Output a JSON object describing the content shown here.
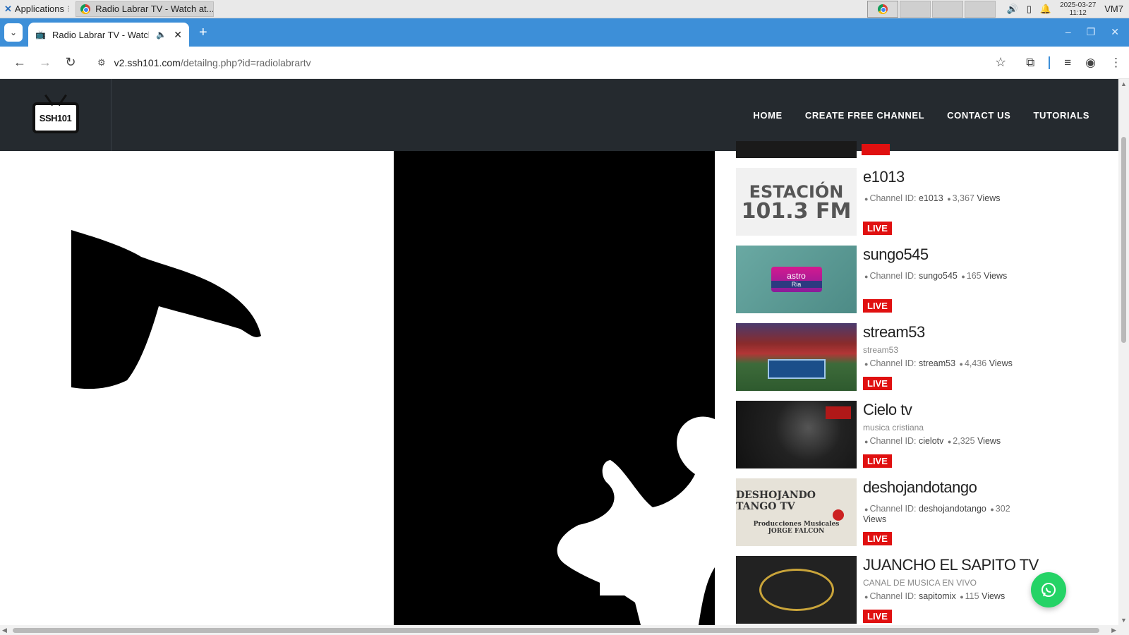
{
  "taskbar": {
    "apps_label": "Applications",
    "window_title": "Radio Labrar TV - Watch at...",
    "date": "2025-03-27",
    "time": "11:12",
    "user": "VM7"
  },
  "browser": {
    "tab_title": "Radio Labrar TV - Watch",
    "url_host": "v2.ssh101.com",
    "url_path": "/detailng.php?id=radiolabrartv"
  },
  "site": {
    "logo_text": "SSH",
    "logo_num": "101",
    "nav": [
      "HOME",
      "CREATE FREE CHANNEL",
      "CONTACT US",
      "TUTORIALS"
    ]
  },
  "channels": [
    {
      "name": "e1013",
      "subtitle": "",
      "channel_id_label": "Channel ID:",
      "channel_id": "e1013",
      "views": "3,367",
      "views_label": "Views",
      "live": "LIVE",
      "thumb_lines": [
        "ESTACIÓN",
        "101.3 FM"
      ]
    },
    {
      "name": "sungo545",
      "subtitle": "",
      "channel_id_label": "Channel ID:",
      "channel_id": "sungo545",
      "views": "165",
      "views_label": "Views",
      "live": "LIVE",
      "thumb_lines": [
        "astro",
        "Ria"
      ]
    },
    {
      "name": "stream53",
      "subtitle": "stream53",
      "channel_id_label": "Channel ID:",
      "channel_id": "stream53",
      "views": "4,436",
      "views_label": "Views",
      "live": "LIVE"
    },
    {
      "name": "Cielo tv",
      "subtitle": "musica cristiana",
      "channel_id_label": "Channel ID:",
      "channel_id": "cielotv",
      "views": "2,325",
      "views_label": "Views",
      "live": "LIVE"
    },
    {
      "name": "deshojandotango",
      "subtitle": "",
      "channel_id_label": "Channel ID:",
      "channel_id": "deshojandotango",
      "views": "302",
      "views_label": "Views",
      "live": "LIVE",
      "thumb_lines": [
        "DESHOJANDO TANGO TV",
        "Producciones Musicales",
        "JORGE FALCON"
      ]
    },
    {
      "name": "JUANCHO EL SAPITO TV",
      "subtitle": "CANAL DE MUSICA EN VIVO",
      "channel_id_label": "Channel ID:",
      "channel_id": "sapitomix",
      "views": "115",
      "views_label": "Views",
      "live": "LIVE"
    }
  ]
}
